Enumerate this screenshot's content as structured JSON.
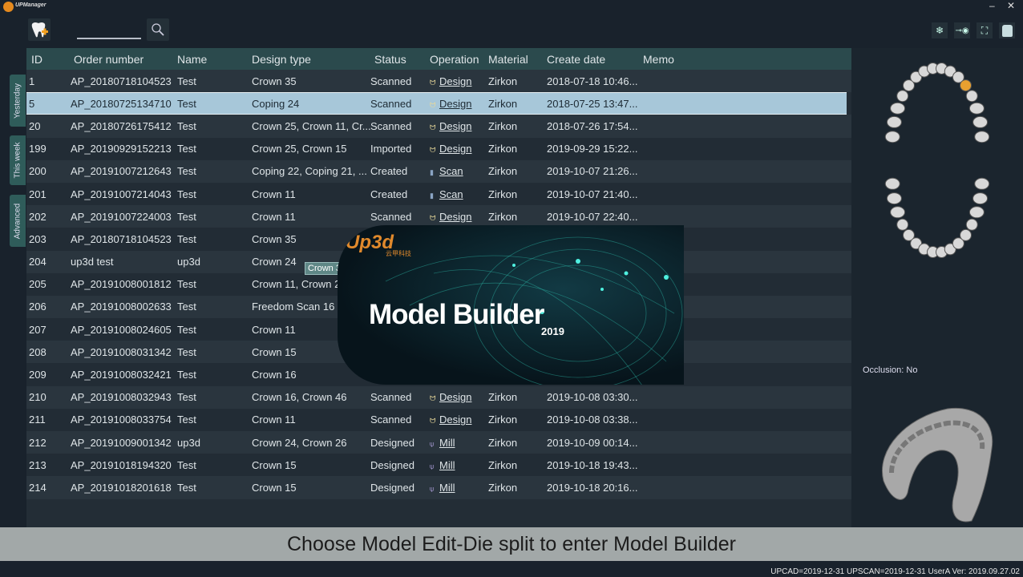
{
  "app": {
    "title": "UPManager"
  },
  "toolbar": {
    "search_value": ""
  },
  "sidetabs": [
    "Yesterday",
    "This week",
    "Advanced"
  ],
  "columns": [
    "ID",
    "Order number",
    "Name",
    "Design type",
    "Status",
    "Operation",
    "Material",
    "Create date",
    "Memo"
  ],
  "rows": [
    {
      "id": "1",
      "order": "AP_20180718104523",
      "name": "Test",
      "type": "Crown 35",
      "status": "Scanned",
      "op": "Design",
      "opicon": "tooth",
      "material": "Zirkon",
      "date": "2018-07-18 10:46..."
    },
    {
      "id": "5",
      "order": "AP_20180725134710",
      "name": "Test",
      "type": "Coping 24",
      "status": "Scanned",
      "op": "Design",
      "opicon": "tooth",
      "material": "Zirkon",
      "date": "2018-07-25 13:47...",
      "selected": true
    },
    {
      "id": "20",
      "order": "AP_20180726175412",
      "name": "Test",
      "type": "Crown 25, Crown 11, Cr...",
      "status": "Scanned",
      "op": "Design",
      "opicon": "tooth",
      "material": "Zirkon",
      "date": "2018-07-26 17:54..."
    },
    {
      "id": "199",
      "order": "AP_20190929152213",
      "name": "Test",
      "type": "Crown 25, Crown 15",
      "status": "Imported",
      "op": "Design",
      "opicon": "tooth",
      "material": "Zirkon",
      "date": "2019-09-29 15:22..."
    },
    {
      "id": "200",
      "order": "AP_20191007212643",
      "name": "Test",
      "type": "Coping 22, Coping 21, ...",
      "status": "Created",
      "op": "Scan",
      "opicon": "scan",
      "material": "Zirkon",
      "date": "2019-10-07 21:26..."
    },
    {
      "id": "201",
      "order": "AP_20191007214043",
      "name": "Test",
      "type": "Crown 11",
      "status": "Created",
      "op": "Scan",
      "opicon": "scan",
      "material": "Zirkon",
      "date": "2019-10-07 21:40..."
    },
    {
      "id": "202",
      "order": "AP_20191007224003",
      "name": "Test",
      "type": "Crown 11",
      "status": "Scanned",
      "op": "Design",
      "opicon": "tooth",
      "material": "Zirkon",
      "date": "2019-10-07 22:40..."
    },
    {
      "id": "203",
      "order": "AP_20180718104523",
      "name": "Test",
      "type": "Crown 35"
    },
    {
      "id": "204",
      "order": "up3d test",
      "name": "up3d",
      "type": "Crown 24"
    },
    {
      "id": "205",
      "order": "AP_20191008001812",
      "name": "Test",
      "type": "Crown 11, Crown 2"
    },
    {
      "id": "206",
      "order": "AP_20191008002633",
      "name": "Test",
      "type": "Freedom Scan 16"
    },
    {
      "id": "207",
      "order": "AP_20191008024605",
      "name": "Test",
      "type": "Crown 11"
    },
    {
      "id": "208",
      "order": "AP_20191008031342",
      "name": "Test",
      "type": "Crown 15"
    },
    {
      "id": "209",
      "order": "AP_20191008032421",
      "name": "Test",
      "type": "Crown 16"
    },
    {
      "id": "210",
      "order": "AP_20191008032943",
      "name": "Test",
      "type": "Crown 16, Crown 46",
      "status": "Scanned",
      "op": "Design",
      "opicon": "tooth",
      "material": "Zirkon",
      "date": "2019-10-08 03:30..."
    },
    {
      "id": "211",
      "order": "AP_20191008033754",
      "name": "Test",
      "type": "Crown 11",
      "status": "Scanned",
      "op": "Design",
      "opicon": "tooth",
      "material": "Zirkon",
      "date": "2019-10-08 03:38..."
    },
    {
      "id": "212",
      "order": "AP_20191009001342",
      "name": "up3d",
      "type": "Crown 24, Crown 26",
      "status": "Designed",
      "op": "Mill",
      "opicon": "mill",
      "material": "Zirkon",
      "date": "2019-10-09 00:14..."
    },
    {
      "id": "213",
      "order": "AP_20191018194320",
      "name": "Test",
      "type": "Crown 15",
      "status": "Designed",
      "op": "Mill",
      "opicon": "mill",
      "material": "Zirkon",
      "date": "2019-10-18 19:43..."
    },
    {
      "id": "214",
      "order": "AP_20191018201618",
      "name": "Test",
      "type": "Crown 15",
      "status": "Designed",
      "op": "Mill",
      "opicon": "mill",
      "material": "Zirkon",
      "date": "2019-10-18 20:16..."
    }
  ],
  "tooltip": "Crown 35",
  "splash": {
    "brand": "Up3d",
    "brand_sub": "云甲科技",
    "title": "Model Builder",
    "year": "2019"
  },
  "right_panel": {
    "occlusion": "Occlusion: No"
  },
  "caption": "Choose Model Edit-Die split to enter Model Builder",
  "status_bar": "UPCAD=2019-12-31  UPSCAN=2019-12-31   UserA   Ver: 2019.09.27.02",
  "colors": {
    "accent": "#2b4a4d",
    "selected_row": "#a7c7d9",
    "highlight_tooth": "#e8a030"
  }
}
